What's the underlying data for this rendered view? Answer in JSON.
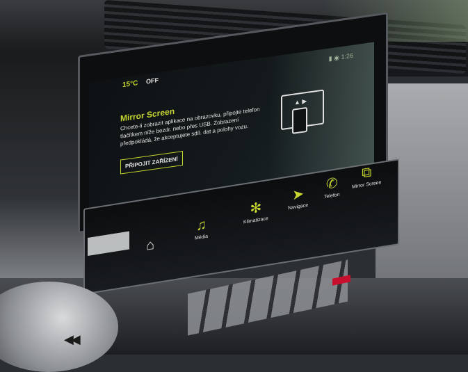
{
  "screen": {
    "status": {
      "ac": "15°C",
      "ac_state": "OFF"
    },
    "mirror": {
      "title": "Mirror Screen",
      "description": "Chcete-li zobrazit aplikace na obrazovku, připojte telefon tlačítkem níže bezdr. nebo přes USB. Zobrazení předpokládá, že akceptujete sdíl. dat a polohy vozu.",
      "connect_label": "PŘIPOJIT ZAŘÍZENÍ"
    }
  },
  "touchbar": {
    "items": [
      {
        "label": "",
        "icon": "home-icon",
        "glyph": "⌂"
      },
      {
        "label": "Média",
        "icon": "music-icon",
        "glyph": "♫"
      },
      {
        "label": "Klimatizace",
        "icon": "fan-icon",
        "glyph": "✻"
      },
      {
        "label": "Navigace",
        "icon": "navigation-icon",
        "glyph": "➤"
      },
      {
        "label": "Telefon",
        "icon": "phone-icon",
        "glyph": "✆"
      },
      {
        "label": "Mirror Screen",
        "icon": "mirror-screen-icon",
        "glyph": "⧉"
      }
    ]
  },
  "colors": {
    "accent": "#c7d630",
    "text": "#e6e6e6",
    "screen_bg": "#0e1113"
  }
}
